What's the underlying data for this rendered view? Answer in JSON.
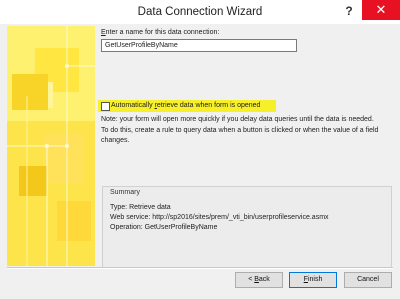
{
  "window": {
    "title": "Data Connection Wizard",
    "help_label": "?",
    "close_label": "✕"
  },
  "form": {
    "name_label_mnemonic": "E",
    "name_label_rest": "nter a name for this data connection:",
    "name_value": "GetUserProfileByName",
    "auto_retrieve_pre": "Automatically ",
    "auto_retrieve_mnemonic": "r",
    "auto_retrieve_post": "etrieve data when form is opened",
    "auto_retrieve_checked": false,
    "note_line1": "Note: your form will open more quickly if you delay data queries until the data is needed.",
    "note_line2": "To do this, create a rule to query data when a button is clicked or when the value of a field",
    "note_line3": "changes."
  },
  "summary": {
    "title": "Summary",
    "type_line": "Type: Retrieve data",
    "service_line": "Web service: http://sp2016/sites/prem/_vti_bin/userprofileservice.asmx",
    "operation_line": "Operation: GetUserProfileByName"
  },
  "buttons": {
    "back_prefix": "< ",
    "back_mnemonic": "B",
    "back_rest": "ack",
    "finish_mnemonic": "F",
    "finish_rest": "inish",
    "cancel_label": "Cancel"
  },
  "colors": {
    "highlight": "#f6ef2a",
    "art": "#fde44a",
    "close": "#e81123"
  }
}
